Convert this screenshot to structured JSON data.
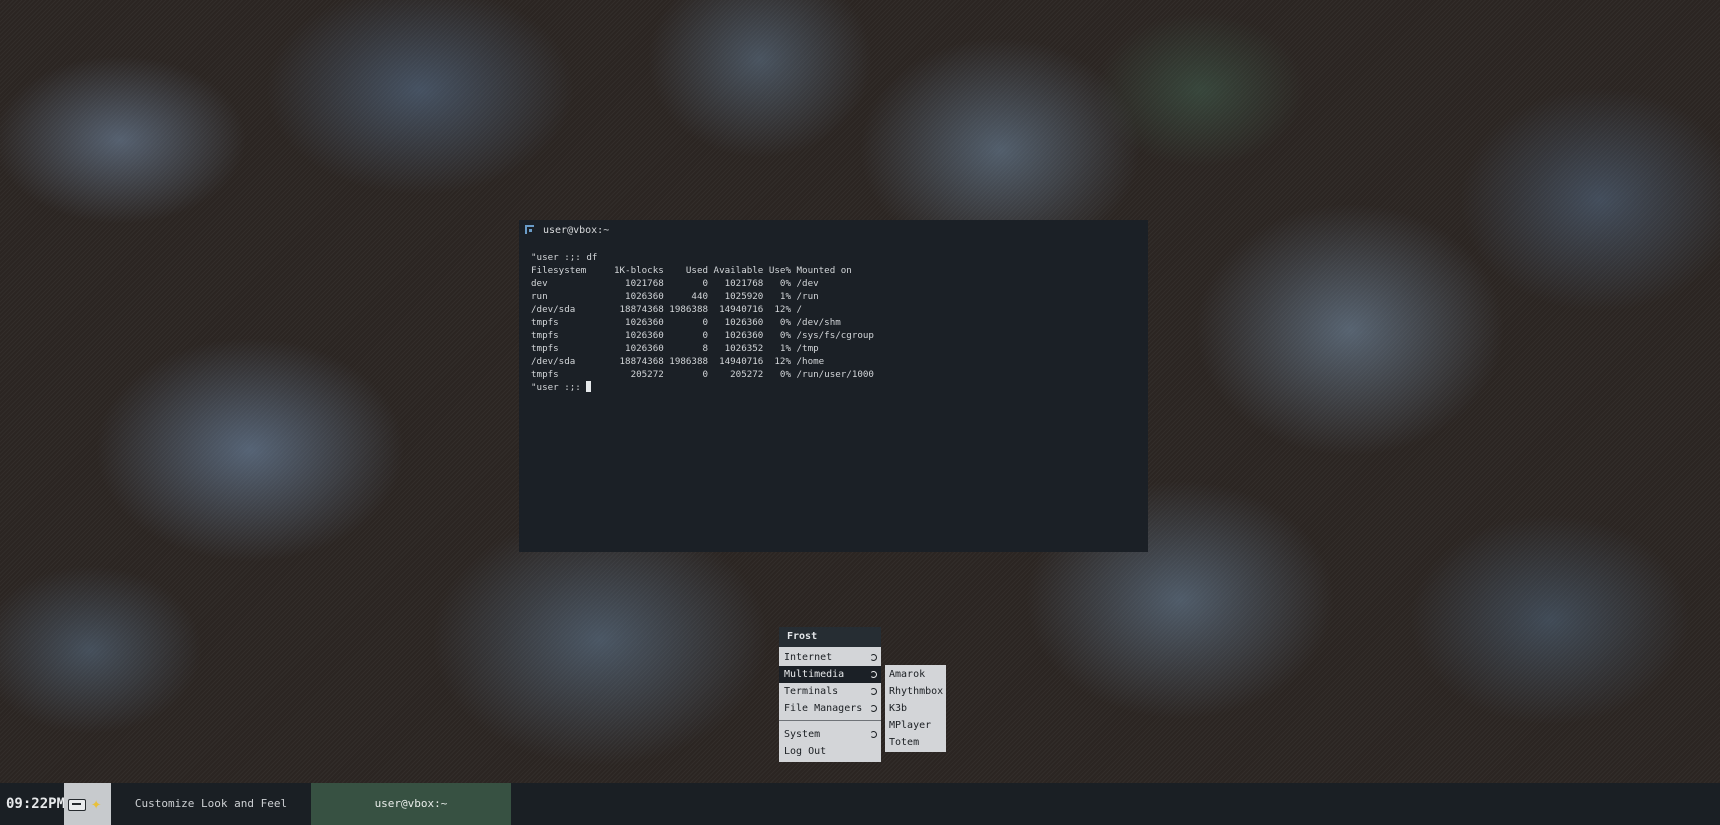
{
  "terminal": {
    "title": "user@vbox:~",
    "output": "\"user :;: df\nFilesystem     1K-blocks    Used Available Use% Mounted on\ndev              1021768       0   1021768   0% /dev\nrun              1026360     440   1025920   1% /run\n/dev/sda        18874368 1986388  14940716  12% /\ntmpfs            1026360       0   1026360   0% /dev/shm\ntmpfs            1026360       0   1026360   0% /sys/fs/cgroup\ntmpfs            1026360       8   1026352   1% /tmp\n/dev/sda        18874368 1986388  14940716  12% /home\ntmpfs             205272       0    205272   0% /run/user/1000\n",
    "prompt": "\"user :;: "
  },
  "menu": {
    "title": "Frost",
    "items": [
      {
        "label": "Internet"
      },
      {
        "label": "Multimedia"
      },
      {
        "label": "Terminals"
      },
      {
        "label": "File Managers"
      },
      {
        "label": "System"
      },
      {
        "label": "Log Out"
      }
    ],
    "submenu": [
      "Amarok",
      "Rhythmbox",
      "K3b",
      "MPlayer",
      "Totem"
    ]
  },
  "taskbar": {
    "clock": "09:22PM",
    "tray_icons": [
      "keyboard-icon",
      "star-icon"
    ],
    "tasks": [
      {
        "label": "Customize Look and Feel"
      },
      {
        "label": "user@vbox:~"
      }
    ]
  },
  "colors": {
    "terminal_bg": "#1b2026",
    "menu_bg": "#d3d5d8",
    "active_task": "#375142",
    "taskbar_bg": "#1a1f24"
  }
}
